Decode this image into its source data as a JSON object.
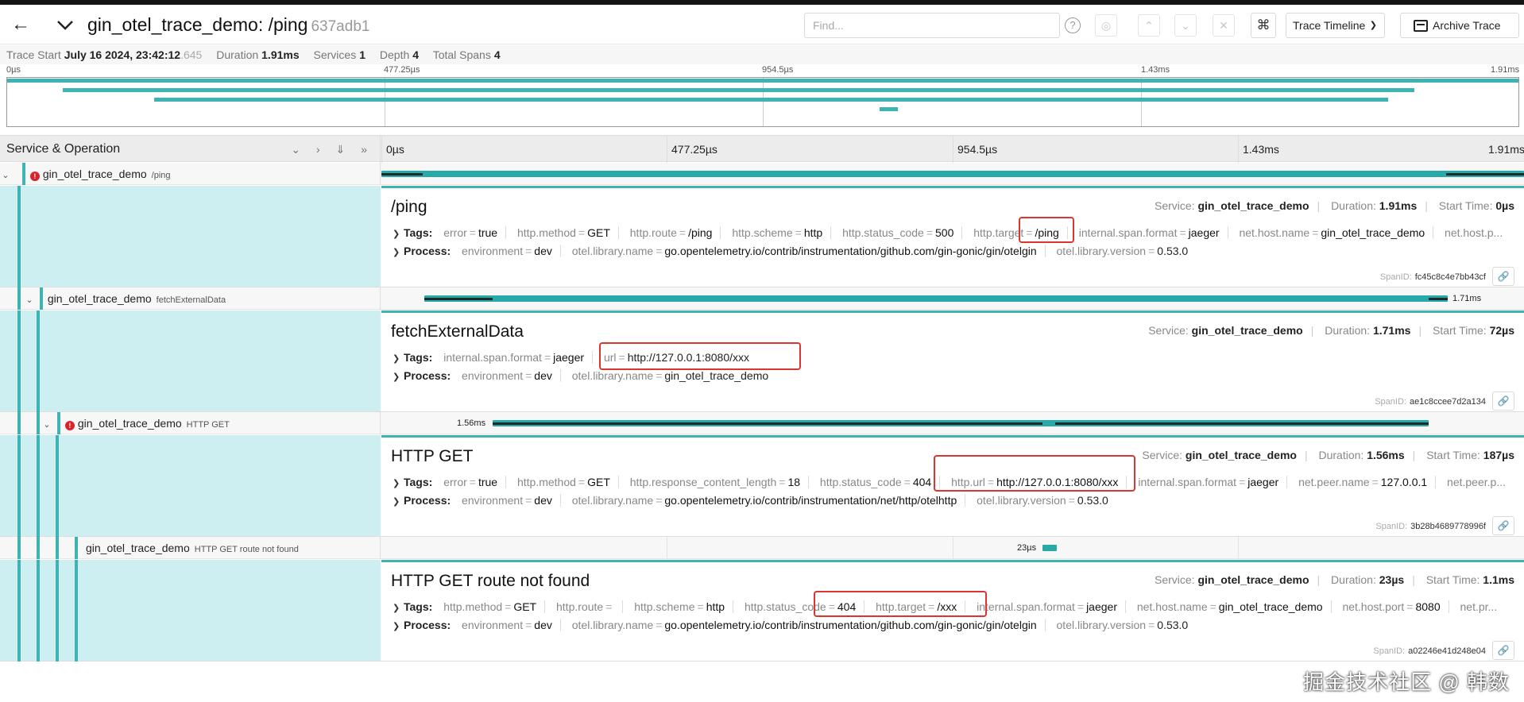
{
  "header": {
    "title": "gin_otel_trace_demo: /ping",
    "trace_id_short": "637adb1",
    "find_placeholder": "Find...",
    "view_select": "Trace Timeline",
    "archive_label": "Archive Trace"
  },
  "summary": {
    "trace_start_label": "Trace Start",
    "trace_start": "July 16 2024, 23:42:12",
    "trace_start_ms": ".645",
    "duration_label": "Duration",
    "duration": "1.91ms",
    "services_label": "Services",
    "services": "1",
    "depth_label": "Depth",
    "depth": "4",
    "total_spans_label": "Total Spans",
    "total_spans": "4"
  },
  "ticks": [
    "0µs",
    "477.25µs",
    "954.5µs",
    "1.43ms",
    "1.91ms"
  ],
  "table_header": {
    "label": "Service & Operation"
  },
  "spans": [
    {
      "service": "gin_otel_trace_demo",
      "operation": "/ping",
      "error": true,
      "detail": {
        "title": "/ping",
        "service_label": "Service:",
        "service": "gin_otel_trace_demo",
        "duration_label": "Duration:",
        "duration": "1.91ms",
        "start_label": "Start Time:",
        "start": "0µs",
        "tags_label": "Tags:",
        "tags": [
          {
            "k": "error",
            "v": "true"
          },
          {
            "k": "http.method",
            "v": "GET"
          },
          {
            "k": "http.route",
            "v": "/ping"
          },
          {
            "k": "http.scheme",
            "v": "http"
          },
          {
            "k": "http.status_code",
            "v": "500"
          },
          {
            "k": "http.target",
            "v": "/ping"
          },
          {
            "k": "internal.span.format",
            "v": "jaeger"
          },
          {
            "k": "net.host.name",
            "v": "gin_otel_trace_demo"
          },
          {
            "k": "net.host.p...",
            "v": ""
          }
        ],
        "process_label": "Process:",
        "process": [
          {
            "k": "environment",
            "v": "dev"
          },
          {
            "k": "otel.library.name",
            "v": "go.opentelemetry.io/contrib/instrumentation/github.com/gin-gonic/gin/otelgin"
          },
          {
            "k": "otel.library.version",
            "v": "0.53.0"
          }
        ],
        "spanid_label": "SpanID:",
        "spanid": "fc45c8c4e7bb43cf"
      }
    },
    {
      "service": "gin_otel_trace_demo",
      "operation": "fetchExternalData",
      "error": false,
      "bar_label": "1.71ms",
      "detail": {
        "title": "fetchExternalData",
        "service_label": "Service:",
        "service": "gin_otel_trace_demo",
        "duration_label": "Duration:",
        "duration": "1.71ms",
        "start_label": "Start Time:",
        "start": "72µs",
        "tags_label": "Tags:",
        "tags": [
          {
            "k": "internal.span.format",
            "v": "jaeger"
          },
          {
            "k": "url",
            "v": "http://127.0.0.1:8080/xxx"
          }
        ],
        "process_label": "Process:",
        "process": [
          {
            "k": "environment",
            "v": "dev"
          },
          {
            "k": "otel.library.name",
            "v": "gin_otel_trace_demo"
          }
        ],
        "spanid_label": "SpanID:",
        "spanid": "ae1c8ccee7d2a134"
      }
    },
    {
      "service": "gin_otel_trace_demo",
      "operation": "HTTP GET",
      "error": true,
      "bar_label": "1.56ms",
      "detail": {
        "title": "HTTP GET",
        "service_label": "Service:",
        "service": "gin_otel_trace_demo",
        "duration_label": "Duration:",
        "duration": "1.56ms",
        "start_label": "Start Time:",
        "start": "187µs",
        "tags_label": "Tags:",
        "tags": [
          {
            "k": "error",
            "v": "true"
          },
          {
            "k": "http.method",
            "v": "GET"
          },
          {
            "k": "http.response_content_length",
            "v": "18"
          },
          {
            "k": "http.status_code",
            "v": "404"
          },
          {
            "k": "http.url",
            "v": "http://127.0.0.1:8080/xxx"
          },
          {
            "k": "internal.span.format",
            "v": "jaeger"
          },
          {
            "k": "net.peer.name",
            "v": "127.0.0.1"
          },
          {
            "k": "net.peer.p...",
            "v": ""
          }
        ],
        "process_label": "Process:",
        "process": [
          {
            "k": "environment",
            "v": "dev"
          },
          {
            "k": "otel.library.name",
            "v": "go.opentelemetry.io/contrib/instrumentation/net/http/otelhttp"
          },
          {
            "k": "otel.library.version",
            "v": "0.53.0"
          }
        ],
        "spanid_label": "SpanID:",
        "spanid": "3b28b4689778996f"
      }
    },
    {
      "service": "gin_otel_trace_demo",
      "operation": "HTTP GET route not found",
      "error": false,
      "bar_label": "23µs",
      "detail": {
        "title": "HTTP GET route not found",
        "service_label": "Service:",
        "service": "gin_otel_trace_demo",
        "duration_label": "Duration:",
        "duration": "23µs",
        "start_label": "Start Time:",
        "start": "1.1ms",
        "tags_label": "Tags:",
        "tags": [
          {
            "k": "http.method",
            "v": "GET"
          },
          {
            "k": "http.route",
            "v": ""
          },
          {
            "k": "http.scheme",
            "v": "http"
          },
          {
            "k": "http.status_code",
            "v": "404"
          },
          {
            "k": "http.target",
            "v": "/xxx"
          },
          {
            "k": "internal.span.format",
            "v": "jaeger"
          },
          {
            "k": "net.host.name",
            "v": "gin_otel_trace_demo"
          },
          {
            "k": "net.host.port",
            "v": "8080"
          },
          {
            "k": "net.pr...",
            "v": ""
          }
        ],
        "process_label": "Process:",
        "process": [
          {
            "k": "environment",
            "v": "dev"
          },
          {
            "k": "otel.library.name",
            "v": "go.opentelemetry.io/contrib/instrumentation/github.com/gin-gonic/gin/otelgin"
          },
          {
            "k": "otel.library.version",
            "v": "0.53.0"
          }
        ],
        "spanid_label": "SpanID:",
        "spanid": "a02246e41d248e04"
      }
    }
  ],
  "watermark": "掘金技术社区 @ 韩数",
  "colors": {
    "accent": "#3fb3b3",
    "error": "#d9252a",
    "highlight": "#d9362f"
  }
}
